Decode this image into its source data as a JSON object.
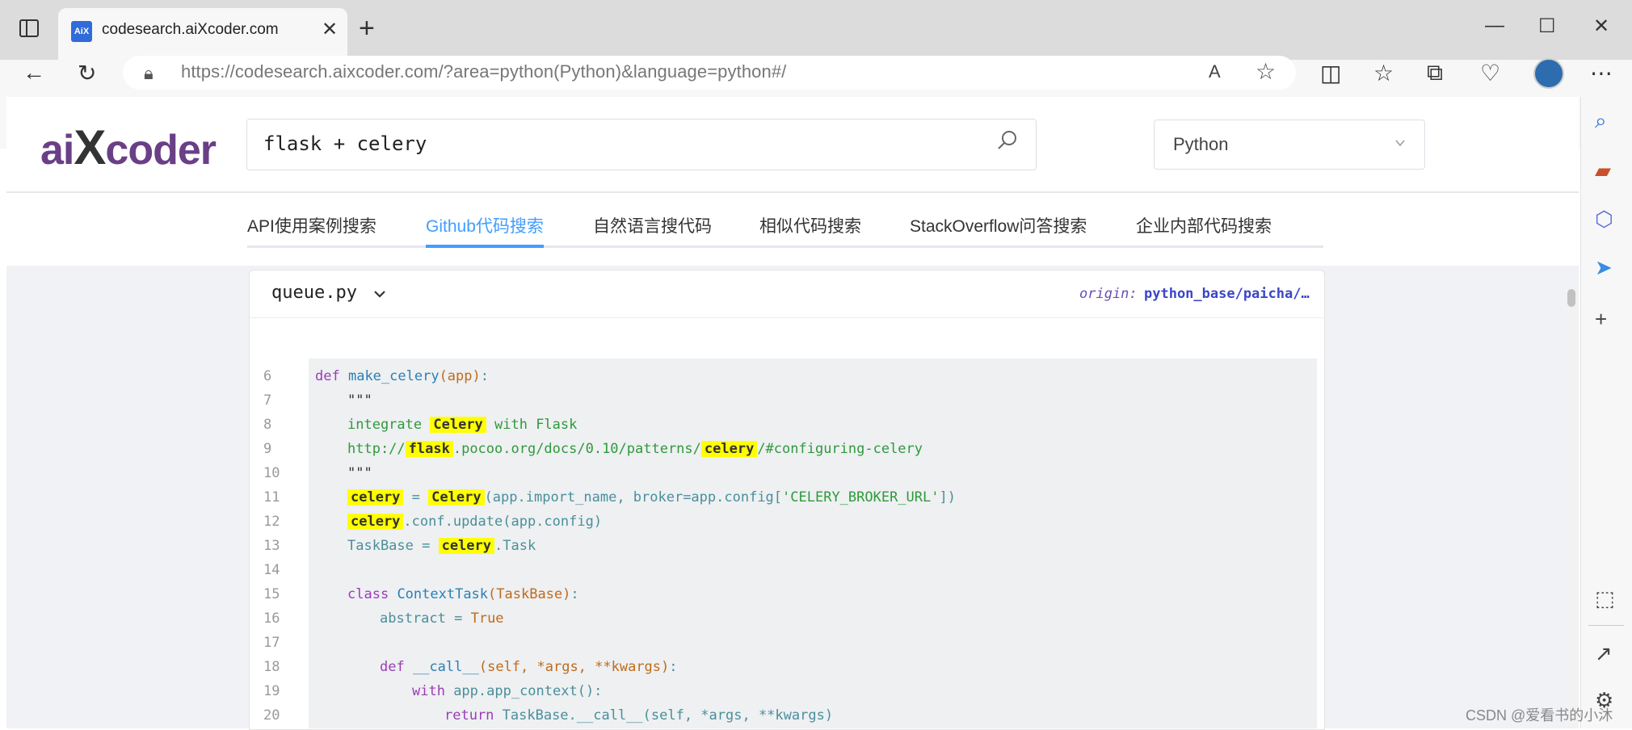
{
  "browser": {
    "tab_title": "codesearch.aiXcoder.com",
    "favicon_text": "AiX",
    "url": "https://codesearch.aixcoder.com/?area=python(Python)&language=python#/",
    "window_controls": {
      "minimize": "—",
      "maximize": "☐",
      "close": "✕"
    }
  },
  "header": {
    "logo_part1": "ai",
    "logo_x": "X",
    "logo_part2": "coder",
    "search_value": "flask + celery",
    "language_select": "Python"
  },
  "nav_tabs": [
    {
      "label": "API使用案例搜索"
    },
    {
      "label": "Github代码搜索"
    },
    {
      "label": "自然语言搜代码"
    },
    {
      "label": "相似代码搜索"
    },
    {
      "label": "StackOverflow问答搜索"
    },
    {
      "label": "企业内部代码搜索"
    }
  ],
  "active_tab_index": 1,
  "result": {
    "file_name": "queue.py",
    "origin_label": "origin:",
    "origin_value": "python_base/paicha/…",
    "line_numbers": [
      "6",
      "7",
      "8",
      "9",
      "10",
      "11",
      "12",
      "13",
      "14",
      "15",
      "16",
      "17",
      "18",
      "19",
      "20"
    ],
    "code": {
      "l6_kw": "def",
      "l6_fn": "make_celery",
      "l6_par": "(app)",
      "l6_end": ":",
      "l7": "\"\"\"",
      "l8_a": "integrate ",
      "l8_hl": "Celery",
      "l8_b": " with Flask",
      "l9_a": "http://",
      "l9_hl1": "flask",
      "l9_b": ".pocoo.org/docs/0.10/patterns/",
      "l9_hl2": "celery",
      "l9_c": "/#configuring-celery",
      "l10": "\"\"\"",
      "l11_hl1": "celery",
      "l11_a": " = ",
      "l11_hl2": "Celery",
      "l11_b": "(app.import_name, broker=app.config[",
      "l11_str": "'CELERY_BROKER_URL'",
      "l11_c": "])",
      "l12_hl": "celery",
      "l12_a": ".conf.update(app.config)",
      "l13_a": "TaskBase = ",
      "l13_hl": "celery",
      "l13_b": ".Task",
      "l15_kw": "class",
      "l15_fn": "ContextTask",
      "l15_par": "(TaskBase)",
      "l15_end": ":",
      "l16_a": "abstract = ",
      "l16_b": "True",
      "l18_kw": "def",
      "l18_fn": "__call__",
      "l18_par": "(self, *args, **kwargs)",
      "l18_end": ":",
      "l19_kw": "with",
      "l19_a": " app.app_context():",
      "l20_kw": "return",
      "l20_a": " TaskBase.__call__(self, *args, **kwargs)"
    }
  },
  "watermark": "CSDN @爱看书的小沐"
}
